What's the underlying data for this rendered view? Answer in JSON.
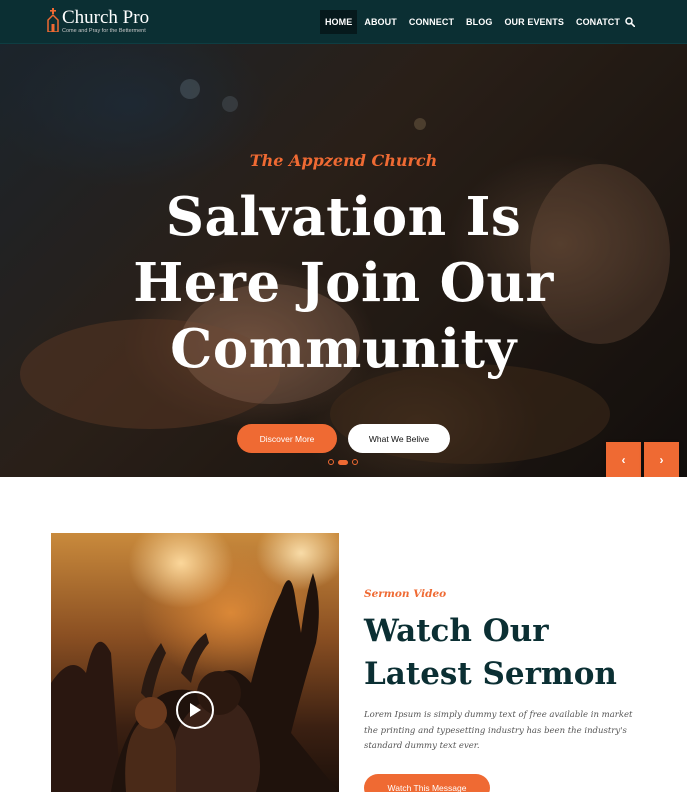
{
  "colors": {
    "accent": "#ef6a33",
    "header_bg": "#0b2f33",
    "heading_dark": "#0b2f33"
  },
  "header": {
    "logo": {
      "name": "Church Pro",
      "tagline": "Come and Pray for the Betterment",
      "icon": "church-logo-icon"
    },
    "nav": [
      {
        "label": "HOME",
        "active": true
      },
      {
        "label": "ABOUT",
        "active": false
      },
      {
        "label": "CONNECT",
        "active": false
      },
      {
        "label": "BLOG",
        "active": false
      },
      {
        "label": "OUR EVENTS",
        "active": false
      },
      {
        "label": "CONATCT",
        "active": false
      }
    ],
    "search_icon": "search-icon"
  },
  "hero": {
    "eyebrow": "The Appzend Church",
    "title_lines": [
      "Salvation Is",
      "Here Join Our",
      "Community"
    ],
    "buttons": {
      "primary": "Discover More",
      "secondary": "What We Belive"
    },
    "slider": {
      "slide_count": 3,
      "active_slide": 2,
      "prev_icon": "chevron-left-icon",
      "next_icon": "chevron-right-icon",
      "prev_glyph": "‹",
      "next_glyph": "›"
    }
  },
  "sermon": {
    "eyebrow": "Sermon Video",
    "title_lines": [
      "Watch Our",
      "Latest Sermon"
    ],
    "description": "Lorem Ipsum is simply dummy text of free available in market the printing and typesetting industry has been the industry's standard dummy text ever.",
    "button": "Watch This Message",
    "play_icon": "play-icon"
  }
}
